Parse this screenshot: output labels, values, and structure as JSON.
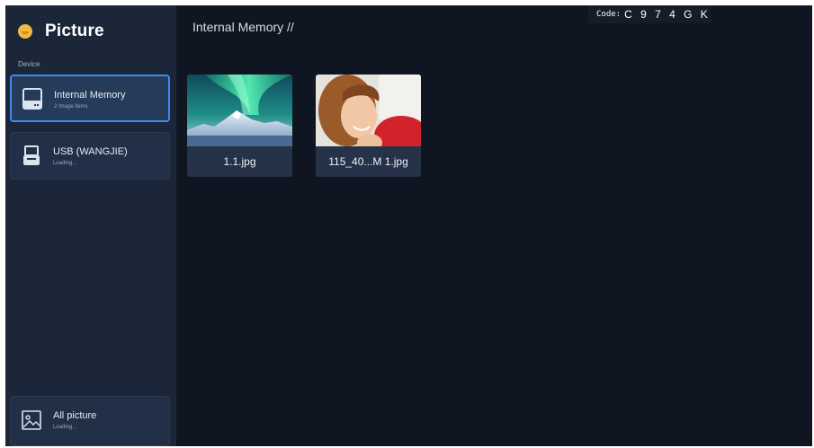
{
  "app": {
    "title": "Picture",
    "logo_icon": "smiley-face-icon"
  },
  "sidebar": {
    "section_label": "Device",
    "devices": [
      {
        "name": "Internal Memory",
        "subtitle": "2 Image items",
        "icon": "hard-drive-icon",
        "selected": true
      },
      {
        "name": "USB (WANGJIE)",
        "subtitle": "Loading...",
        "icon": "usb-drive-icon",
        "selected": false
      }
    ],
    "all_picture": {
      "name": "All picture",
      "subtitle": "Loading...",
      "icon": "image-icon"
    }
  },
  "main": {
    "breadcrumb": "Internal Memory //",
    "code": {
      "label": "Code:",
      "value": "C 9 7 4 G K"
    },
    "files": [
      {
        "name": "1.1.jpg",
        "thumbnail": "aurora-mountain-photo"
      },
      {
        "name": "115_40...M 1.jpg",
        "thumbnail": "woman-portrait-photo"
      }
    ]
  },
  "colors": {
    "background": "#0f1622",
    "sidebar": "#1b2638",
    "card": "#223047",
    "selected_border": "#3d8bf0",
    "logo": "#f0b93f"
  }
}
